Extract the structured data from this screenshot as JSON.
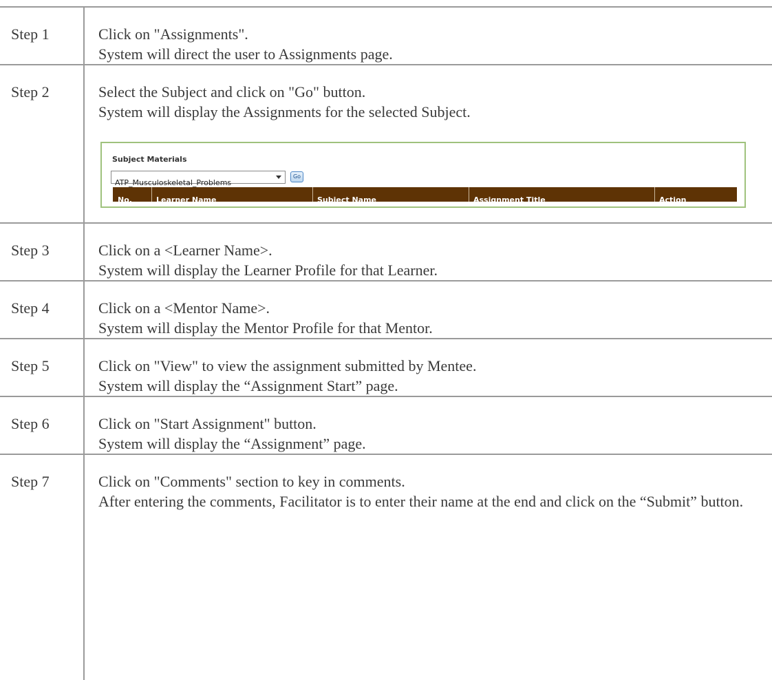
{
  "steps": [
    {
      "label": "Step 1",
      "lines": [
        "Click on \"Assignments\".",
        "System will direct the user to Assignments page."
      ]
    },
    {
      "label": "Step 2",
      "lines": [
        "Select the Subject and click on \"Go\" button.",
        "System will display the Assignments for the selected Subject."
      ]
    },
    {
      "label": "Step 3",
      "lines": [
        "Click on a <Learner Name>.",
        "System will display the Learner Profile for that Learner."
      ]
    },
    {
      "label": "Step 4",
      "lines": [
        "Click on a <Mentor Name>.",
        "System will display the Mentor Profile for that Mentor."
      ]
    },
    {
      "label": "Step 5",
      "lines": [
        "Click on \"View\" to view the assignment submitted by Mentee.",
        "System will display the “Assignment Start” page."
      ]
    },
    {
      "label": "Step 6",
      "lines": [
        "Click on \"Start Assignment\" button.",
        "System will display the “Assignment” page."
      ]
    },
    {
      "label": "Step 7",
      "lines": [
        "Click on \"Comments\" section to key in comments.",
        "After entering the comments, Facilitator is to enter their name at the end and click on the “Submit” button."
      ]
    }
  ],
  "panel": {
    "title": "Subject Materials",
    "subject_select": "ATP_Musculoskeletal_Problems",
    "go_label": "Go",
    "columns": [
      "No.",
      "Learner Name",
      "Subject Name",
      "Assignment Title",
      "Action"
    ],
    "header_color": "#5e3305",
    "border_color": "#9fc27d"
  }
}
